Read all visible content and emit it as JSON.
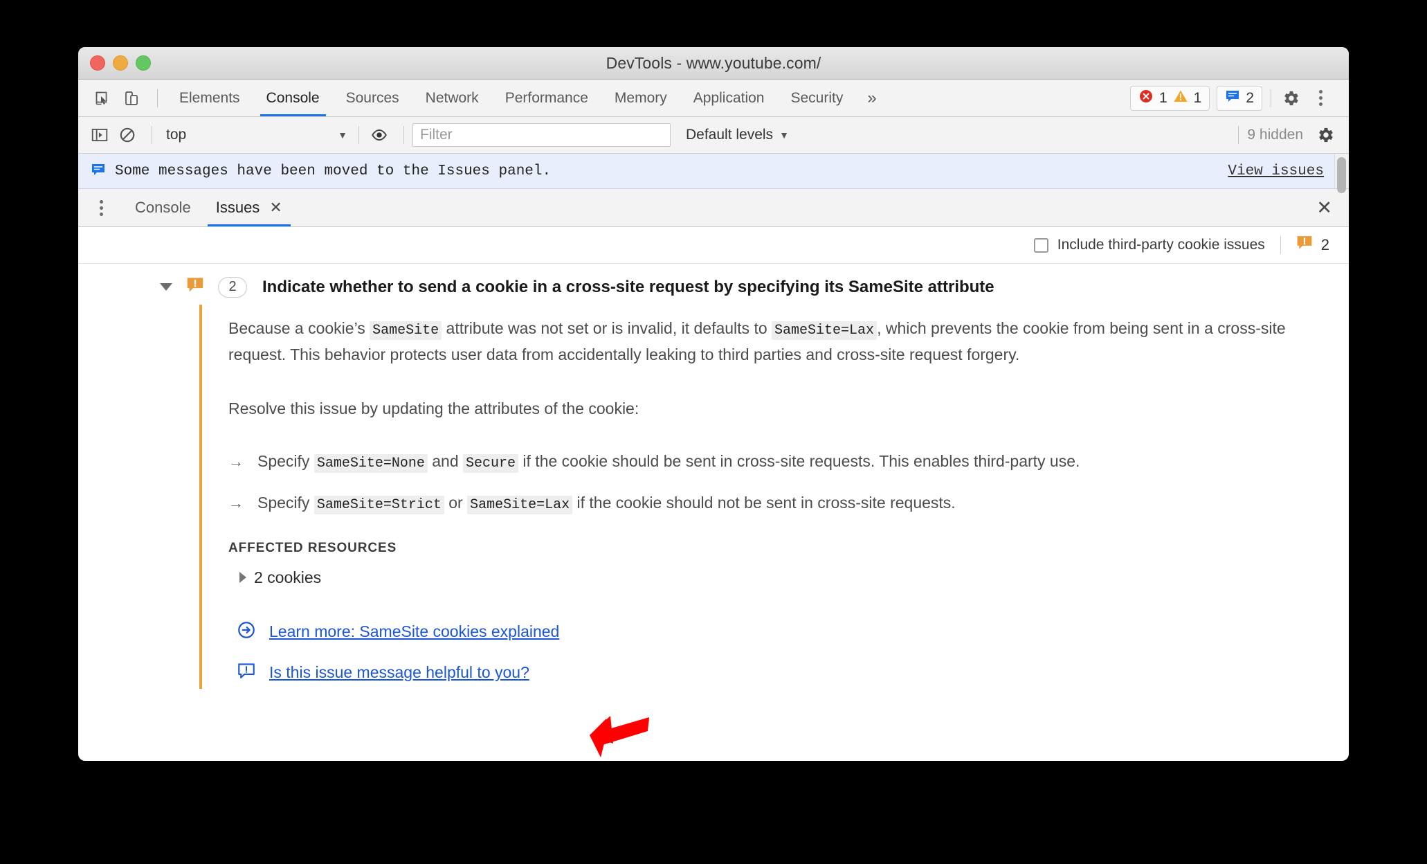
{
  "window": {
    "title": "DevTools - www.youtube.com/",
    "traffic_lights": [
      "close",
      "minimize",
      "maximize"
    ]
  },
  "toolbar": {
    "inspect_icon": "inspect-element-icon",
    "device_icon": "device-toolbar-icon",
    "tabs": [
      {
        "label": "Elements",
        "active": false
      },
      {
        "label": "Console",
        "active": true
      },
      {
        "label": "Sources",
        "active": false
      },
      {
        "label": "Network",
        "active": false
      },
      {
        "label": "Performance",
        "active": false
      },
      {
        "label": "Memory",
        "active": false
      },
      {
        "label": "Application",
        "active": false
      },
      {
        "label": "Security",
        "active": false
      }
    ],
    "more_tabs_label": "»",
    "error_count": "1",
    "warning_count": "1",
    "issue_count": "2",
    "settings_icon": "gear-icon",
    "menu_icon": "kebab-menu-icon"
  },
  "console_toolbar": {
    "sidebar_icon": "console-sidebar-icon",
    "clear_icon": "clear-console-icon",
    "context_value": "top",
    "context_caret": "▼",
    "eye_icon": "live-expression-icon",
    "filter_placeholder": "Filter",
    "filter_value": "",
    "levels_label": "Default levels",
    "levels_caret": "▼",
    "hidden_label": "9 hidden",
    "settings_icon": "gear-icon"
  },
  "console_infobar": {
    "icon": "issue-message-icon",
    "message": "Some messages have been moved to the Issues panel.",
    "view_issues_label": "View issues"
  },
  "drawer": {
    "menu_icon": "kebab-menu-icon",
    "tabs": [
      {
        "label": "Console",
        "active": false,
        "closable": false
      },
      {
        "label": "Issues",
        "active": true,
        "closable": true
      }
    ],
    "close_tab_glyph": "✕",
    "close_drawer_glyph": "✕"
  },
  "issues_toolbar": {
    "checkbox_label": "Include third-party cookie issues",
    "checkbox_checked": false,
    "issue_icon": "issue-warning-icon",
    "issue_count": "2"
  },
  "issue": {
    "expand_glyph": "▼",
    "icon": "issue-warning-icon",
    "count_badge": "2",
    "title": "Indicate whether to send a cookie in a cross-site request by specifying its SameSite attribute",
    "paragraph1": {
      "part1": "Because a cookie’s ",
      "code1": "SameSite",
      "part2": " attribute was not set or is invalid, it defaults to ",
      "code2": "SameSite=Lax",
      "part3": ", which prevents the cookie from being sent in a cross-site request. This behavior protects user data from accidentally leaking to third parties and cross-site request forgery."
    },
    "paragraph2": "Resolve this issue by updating the attributes of the cookie:",
    "bullets": [
      {
        "arrow": "→",
        "part1": "Specify ",
        "code1": "SameSite=None",
        "part2": " and ",
        "code2": "Secure",
        "part3": " if the cookie should be sent in cross-site requests. This enables third-party use."
      },
      {
        "arrow": "→",
        "part1": "Specify ",
        "code1": "SameSite=Strict",
        "part2": " or ",
        "code2": "SameSite=Lax",
        "part3": " if the cookie should not be sent in cross-site requests."
      }
    ],
    "affected_resources_label": "AFFECTED RESOURCES",
    "affected_resources_item": "2 cookies",
    "affected_collapse_glyph": "▸",
    "links": [
      {
        "icon": "arrow-in-circle-icon",
        "label": "Learn more: SameSite cookies explained"
      },
      {
        "icon": "feedback-icon",
        "label": "Is this issue message helpful to you?"
      }
    ]
  },
  "annotation": {
    "arrow_color": "#ff0000",
    "points_to": "Is this issue message helpful to you?"
  },
  "colors": {
    "accent_blue": "#1a73e8",
    "link_blue": "#1a56d6",
    "issue_orange": "#e9a33a",
    "error_red": "#d93025",
    "info_bar_bg": "#e8eefb"
  }
}
